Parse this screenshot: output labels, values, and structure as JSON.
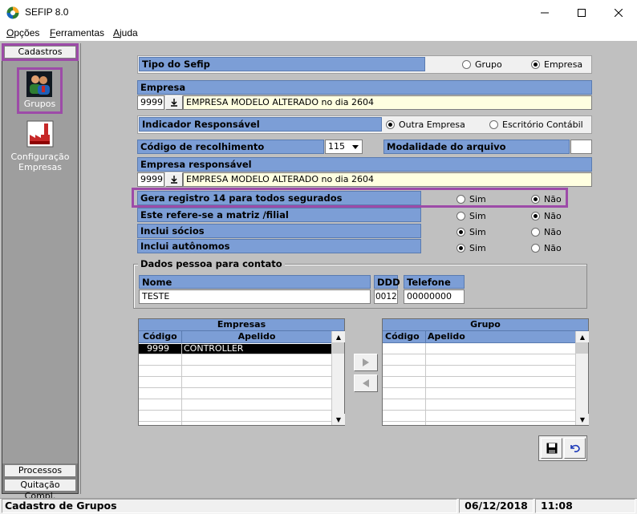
{
  "window": {
    "title": "SEFIP 8.0"
  },
  "menu": [
    {
      "label": "Opções",
      "hotkey": "O"
    },
    {
      "label": "Ferramentas",
      "hotkey": "F"
    },
    {
      "label": "Ajuda",
      "hotkey": "A"
    }
  ],
  "sidebar": {
    "header": "Cadastros",
    "items": [
      {
        "label": "Grupos",
        "icon": "group-people-icon"
      },
      {
        "label": "Configuração Empresas",
        "icon": "factory-icon"
      }
    ],
    "footer": [
      "Processos",
      "Quitação Compl."
    ]
  },
  "form": {
    "tipo_sefip": {
      "label": "Tipo do Sefip",
      "options": [
        "Grupo",
        "Empresa"
      ],
      "selected": "Empresa"
    },
    "empresa": {
      "label": "Empresa",
      "code": "9999",
      "name": "EMPRESA MODELO ALTERADO no dia 2604"
    },
    "indicador": {
      "label": "Indicador Responsável",
      "options": [
        "Outra Empresa",
        "Escritório Contábil"
      ],
      "selected": "Outra Empresa"
    },
    "codigo_recolhimento": {
      "label": "Código de recolhimento",
      "value": "115"
    },
    "modalidade": {
      "label": "Modalidade do arquivo",
      "value": ""
    },
    "empresa_responsavel": {
      "label": "Empresa responsável",
      "code": "9999",
      "name": "EMPRESA MODELO ALTERADO no dia 2604"
    },
    "questions": [
      {
        "label": "Gera registro 14 para todos segurados",
        "yes": "Sim",
        "no": "Não",
        "selected": "Não"
      },
      {
        "label": "Este refere-se a matriz /filial",
        "yes": "Sim",
        "no": "Não",
        "selected": "Não"
      },
      {
        "label": "Inclui sócios",
        "yes": "Sim",
        "no": "Não",
        "selected": "Sim"
      },
      {
        "label": "Inclui autônomos",
        "yes": "Sim",
        "no": "Não",
        "selected": "Sim"
      }
    ],
    "contato": {
      "legend": "Dados pessoa para contato",
      "nome_label": "Nome",
      "nome": "TESTE",
      "ddd_label": "DDD",
      "ddd": "0012",
      "telefone_label": "Telefone",
      "telefone": "00000000"
    }
  },
  "empresas_grid": {
    "title": "Empresas",
    "columns": [
      "Código",
      "Apelido"
    ],
    "rows": [
      {
        "codigo": "9999",
        "apelido": "CONTROLLER"
      }
    ]
  },
  "grupo_grid": {
    "title": "Grupo",
    "columns": [
      "Código",
      "Apelido"
    ],
    "rows": []
  },
  "status": {
    "text": "Cadastro de Grupos",
    "date": "06/12/2018",
    "time": "11:08"
  },
  "colors": {
    "header_blue": "#7c9ed6",
    "highlight": "#9d4ba8",
    "field_yellow": "#ffffe0"
  }
}
